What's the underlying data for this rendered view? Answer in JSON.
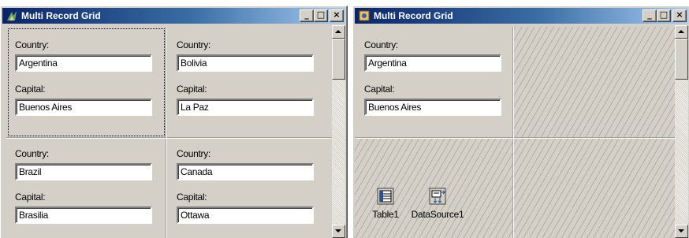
{
  "windows": [
    {
      "title": "Multi Record Grid",
      "records": [
        {
          "country_label": "Country:",
          "country": "Argentina",
          "capital_label": "Capital:",
          "capital": "Buenos Aires"
        },
        {
          "country_label": "Country:",
          "country": "Bolivia",
          "capital_label": "Capital:",
          "capital": "La Paz"
        },
        {
          "country_label": "Country:",
          "country": "Brazil",
          "capital_label": "Capital:",
          "capital": "Brasilia"
        },
        {
          "country_label": "Country:",
          "country": "Canada",
          "capital_label": "Capital:",
          "capital": "Ottawa"
        }
      ]
    },
    {
      "title": "Multi Record Grid",
      "records": [
        {
          "country_label": "Country:",
          "country": "Argentina",
          "capital_label": "Capital:",
          "capital": "Buenos Aires"
        }
      ],
      "components": [
        {
          "label": "Table1",
          "icon": "table-icon"
        },
        {
          "label": "DataSource1",
          "icon": "datasource-icon"
        }
      ]
    }
  ],
  "title_buttons": {
    "minimize": "_",
    "maximize": "□",
    "close": "×"
  },
  "colors": {
    "face": "#d4d0c8",
    "title_start": "#0a246a",
    "title_end": "#a6caf0"
  }
}
